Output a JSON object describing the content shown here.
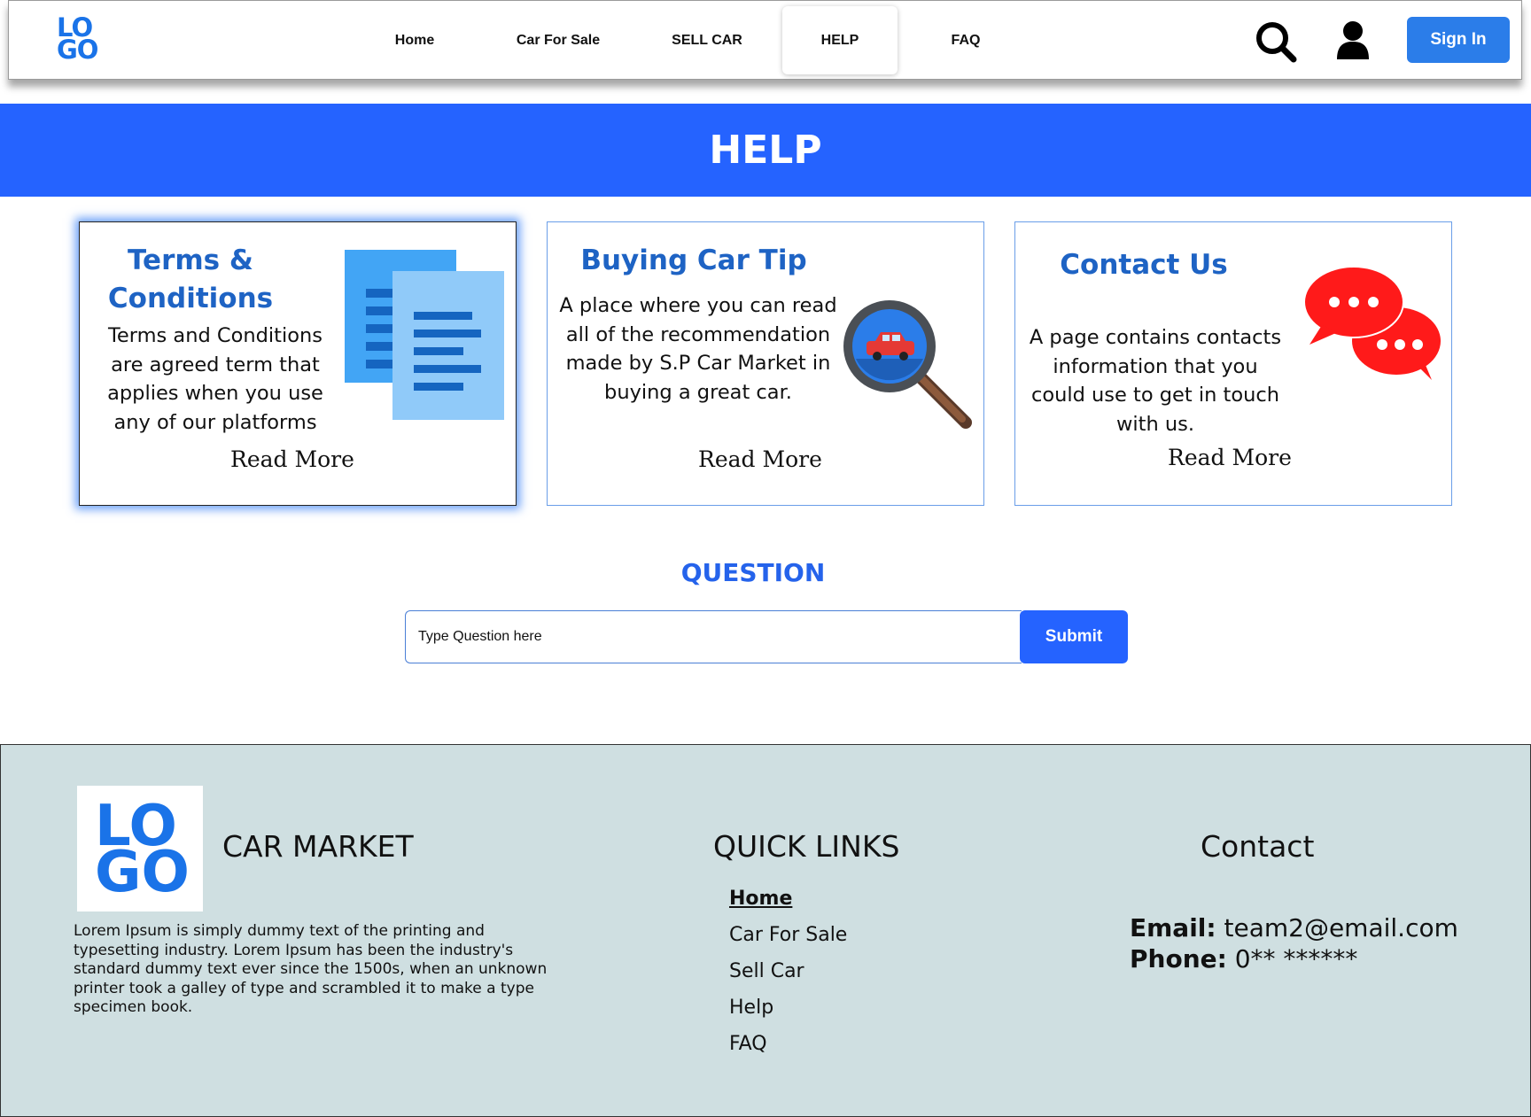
{
  "header": {
    "logo_line1": "LO",
    "logo_line2": "GO",
    "nav": [
      {
        "label": "Home"
      },
      {
        "label": "Car For Sale"
      },
      {
        "label": "SELL CAR"
      },
      {
        "label": "HELP",
        "active": true
      },
      {
        "label": "FAQ"
      }
    ],
    "sign_in": "Sign In",
    "icons": [
      "search-icon",
      "user-icon"
    ]
  },
  "banner": {
    "title": "HELP"
  },
  "cards": [
    {
      "title_line1": "Terms &",
      "title_line2": "Conditions",
      "text_lines": [
        "Terms and Conditions",
        "are agreed term that",
        "applies when you use",
        "any of our platforms"
      ],
      "read_more": "Read More",
      "icon": "documents-icon"
    },
    {
      "title": "Buying Car Tip",
      "text_lines": [
        "A place where you can read",
        "all of the recommendation",
        "made by S.P Car Market in",
        "buying a  great car."
      ],
      "read_more": "Read More",
      "icon": "magnifier-car-icon"
    },
    {
      "title": "Contact Us",
      "text_lines": [
        "A page contains contacts",
        "information that you",
        "could use to get in touch",
        "with us."
      ],
      "read_more": "Read More",
      "icon": "chat-bubbles-icon"
    }
  ],
  "question": {
    "title": "QUESTION",
    "placeholder": "Type Question here",
    "submit": "Submit"
  },
  "footer": {
    "logo_line1": "LO",
    "logo_line2": "GO",
    "brand": "CAR MARKET",
    "description": "Lorem Ipsum is simply dummy text of the printing and typesetting industry. Lorem Ipsum has been the industry's standard dummy text ever since the 1500s, when an unknown printer took a galley of type and scrambled it to make a type specimen book.",
    "quick_links_title": "QUICK LINKS",
    "quick_links": [
      "Home",
      "Car For Sale",
      "Sell Car",
      "Help",
      "FAQ"
    ],
    "contact_title": "Contact",
    "email_label": "Email:",
    "email_value": "team2@email.com",
    "phone_label": "Phone:",
    "phone_value": "0** ******"
  },
  "colors": {
    "brand_blue": "#2563ff",
    "logo_blue": "#1a73e8",
    "card_title_blue": "#1e63c4",
    "footer_bg": "#cfdfe1",
    "signin_blue": "#2b7de9"
  }
}
